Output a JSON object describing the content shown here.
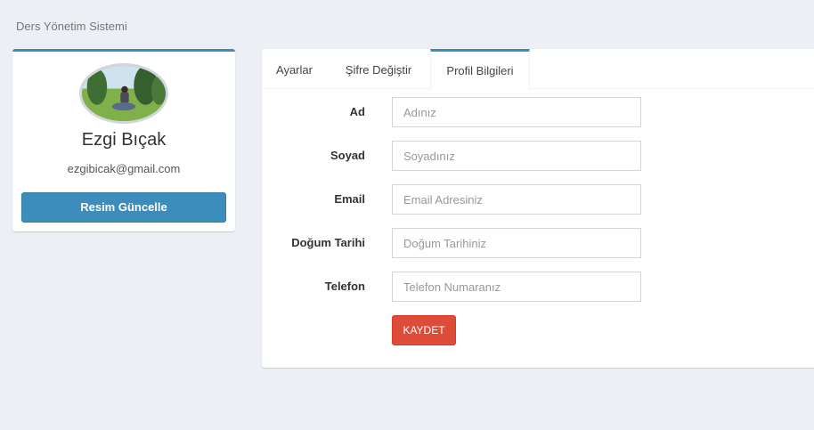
{
  "app": {
    "title": "Ders Yönetim Sistemi"
  },
  "profile": {
    "name": "Ezgi Bıçak",
    "email": "ezgibicak@gmail.com",
    "update_photo_label": "Resim Güncelle"
  },
  "tabs": [
    {
      "label": "Ayarlar",
      "active": false
    },
    {
      "label": "Şifre Değiştir",
      "active": false
    },
    {
      "label": "Profil Bilgileri",
      "active": true
    }
  ],
  "form": {
    "fields": [
      {
        "label": "Ad",
        "placeholder": "Adınız",
        "value": ""
      },
      {
        "label": "Soyad",
        "placeholder": "Soyadınız",
        "value": ""
      },
      {
        "label": "Email",
        "placeholder": "Email Adresiniz",
        "value": ""
      },
      {
        "label": "Doğum Tarihi",
        "placeholder": "Doğum Tarihiniz",
        "value": ""
      },
      {
        "label": "Telefon",
        "placeholder": "Telefon Numaranız",
        "value": ""
      }
    ],
    "save_label": "KAYDET"
  },
  "colors": {
    "primary": "#3c8dbc",
    "danger": "#dd4b39",
    "background": "#ecf0f5"
  }
}
